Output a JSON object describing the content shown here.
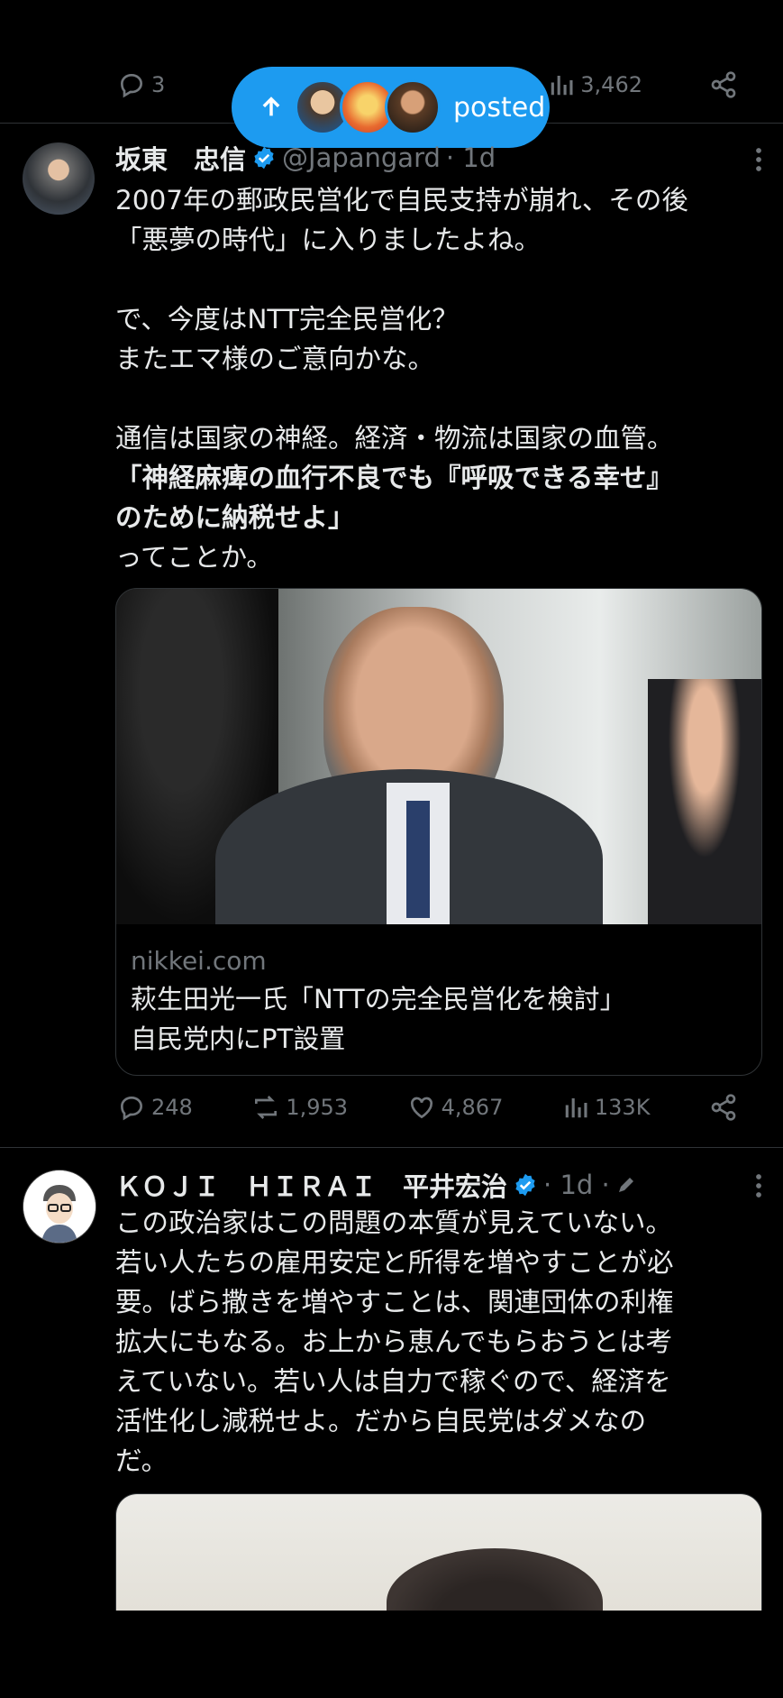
{
  "prev_tweet_actions": {
    "replies": "3",
    "views": "3,462"
  },
  "posted_pill": {
    "label": "posted"
  },
  "tweet1": {
    "name": "坂東　忠信",
    "handle": "@Japangard",
    "time": "· 1d",
    "lines": [
      "2007年の郵政民営化で自民支持が崩れ、その後",
      "「悪夢の時代」に入りましたよね。",
      "",
      "で、今度はNTT完全民営化？",
      "またエマ様のご意向かな。",
      "",
      "通信は国家の神経。経済・物流は国家の血管。",
      "「神経麻痺の血行不良でも『呼吸できる幸せ』",
      "のために納税せよ」",
      "ってことか。"
    ],
    "card": {
      "domain": "nikkei.com",
      "title_line1": "萩生田光一氏「NTTの完全民営化を検討」",
      "title_line2": "自民党内にPT設置"
    },
    "stats": {
      "replies": "248",
      "reposts": "1,953",
      "likes": "4,867",
      "views": "133K"
    }
  },
  "tweet2": {
    "name": "ＫＯＪＩ　ＨＩＲＡＩ　平井宏治",
    "time": "· 1d ·",
    "lines": [
      "この政治家はこの問題の本質が見えていない。",
      "若い人たちの雇用安定と所得を増やすことが必",
      "要。ばら撒きを増やすことは、関連団体の利権",
      "拡大にもなる。お上から恵んでもらおうとは考",
      "えていない。若い人は自力で稼ぐので、経済を",
      "活性化し減税せよ。だから自民党はダメなの",
      "だ。"
    ]
  },
  "colors": {
    "accent": "#1d9bf0",
    "muted": "#71767b",
    "text": "#e7e9ea",
    "bg": "#000000"
  }
}
